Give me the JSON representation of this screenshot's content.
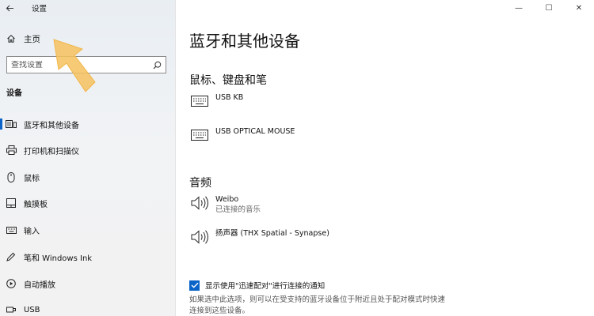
{
  "window": {
    "title": "设置",
    "controls": {
      "minimize": "—",
      "maximize": "☐",
      "close": "✕"
    }
  },
  "sidebar": {
    "home_label": "主页",
    "search_placeholder": "查找设置",
    "section_header": "设备",
    "items": [
      {
        "label": "蓝牙和其他设备",
        "icon": "bluetooth-devices-icon",
        "selected": true
      },
      {
        "label": "打印机和扫描仪",
        "icon": "printer-icon"
      },
      {
        "label": "鼠标",
        "icon": "mouse-icon"
      },
      {
        "label": "触摸板",
        "icon": "touchpad-icon"
      },
      {
        "label": "输入",
        "icon": "keyboard-icon"
      },
      {
        "label": "笔和 Windows Ink",
        "icon": "pen-icon"
      },
      {
        "label": "自动播放",
        "icon": "autoplay-icon"
      },
      {
        "label": "USB",
        "icon": "usb-icon"
      }
    ]
  },
  "main": {
    "page_title": "蓝牙和其他设备",
    "groups": [
      {
        "header": "鼠标、键盘和笔",
        "devices": [
          {
            "name": "USB KB",
            "status": "",
            "icon": "keyboard-icon"
          },
          {
            "name": "USB OPTICAL MOUSE",
            "status": "",
            "icon": "keyboard-icon"
          }
        ]
      },
      {
        "header": "音频",
        "devices": [
          {
            "name": "Weibo",
            "status": "已连接的音乐",
            "icon": "speaker-icon"
          },
          {
            "name": "扬声器 (THX Spatial - Synapse)",
            "status": "",
            "icon": "speaker-icon"
          }
        ]
      }
    ],
    "swift_pair": {
      "checked": true,
      "label": "显示使用\"迅速配对\"进行连接的通知",
      "hint": "如果选中此选项，则可以在受支持的蓝牙设备位于附近且处于配对模式时快速连接到这些设备。"
    }
  },
  "colors": {
    "accent": "#0a64c8",
    "arrow": "#f6c15e"
  }
}
